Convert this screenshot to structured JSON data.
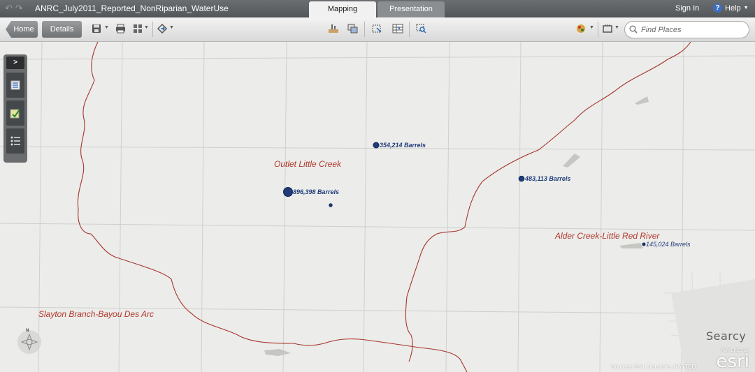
{
  "app": {
    "title": "ANRC_July2011_Reported_NonRiparian_WaterUse",
    "undo_icon": "undo-icon",
    "redo_icon": "redo-icon"
  },
  "tabs": [
    {
      "label": "Mapping",
      "active": true
    },
    {
      "label": "Presentation",
      "active": false
    }
  ],
  "header": {
    "sign_in": "Sign In",
    "help": "Help",
    "help_glyph": "?"
  },
  "toolbar": {
    "home": "Home",
    "details": "Details",
    "icons": [
      "save-icon",
      "print-icon",
      "layout-icon",
      "share-icon",
      "add-data-icon",
      "layers-icon",
      "select-icon",
      "table-icon",
      "zoom-selection-icon",
      "basemap-icon",
      "measure-icon"
    ]
  },
  "search": {
    "placeholder": "Find Places"
  },
  "sidepanel": {
    "expand_glyph": ">",
    "tools": [
      "layer-list-icon",
      "edit-icon",
      "legend-icon"
    ]
  },
  "map": {
    "watershed_labels": [
      {
        "text": "Outlet Little Creek"
      },
      {
        "text": "Alder Creek-Little Red River"
      },
      {
        "text": "Slayton Branch-Bayou Des Arc"
      }
    ],
    "water_use_points": [
      {
        "label": "354,214 Barrels",
        "barrels": 354214
      },
      {
        "label": "896,398 Barrels",
        "barrels": 896398
      },
      {
        "label": "483,113 Barrels",
        "barrels": 483113
      },
      {
        "label": "145,024 Barrels",
        "barrels": 145024
      }
    ],
    "city": "Searcy",
    "attribution": "Sources: Esri, DeLorme, NAVTEQ",
    "powered_by": "POWERED BY",
    "logo_text": "esri",
    "north": "N",
    "colors": {
      "boundary": "#a5352b",
      "point_fill": "#1f3d7a",
      "road": "#c9c9c6",
      "background": "#ececea"
    }
  }
}
